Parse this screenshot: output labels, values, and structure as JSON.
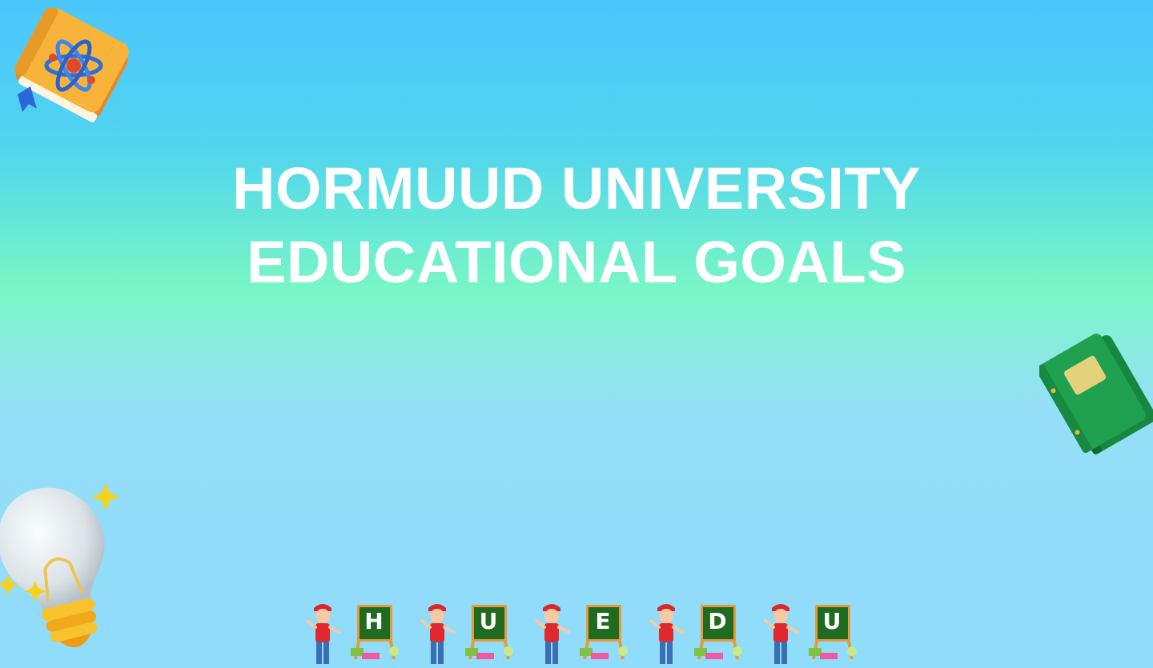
{
  "slide": {
    "title_line1": "HORMUUD UNIVERSITY",
    "title_line2": "EDUCATIONAL GOALS"
  },
  "banner": {
    "letters": [
      "H",
      "U",
      "E",
      "D",
      "U"
    ]
  },
  "icons": {
    "top_left": "atom-book-icon",
    "right": "green-book-icon",
    "bottom_left": "lightbulb-icon",
    "banner_figure": "kid-with-chalkboard-icon"
  },
  "colors": {
    "gradient_top": "#4cc6fd",
    "gradient_mid": "#7af7c4",
    "gradient_bottom": "#8fdcfb",
    "title_text": "#ffffff",
    "chalkboard": "#1f6b1f"
  }
}
